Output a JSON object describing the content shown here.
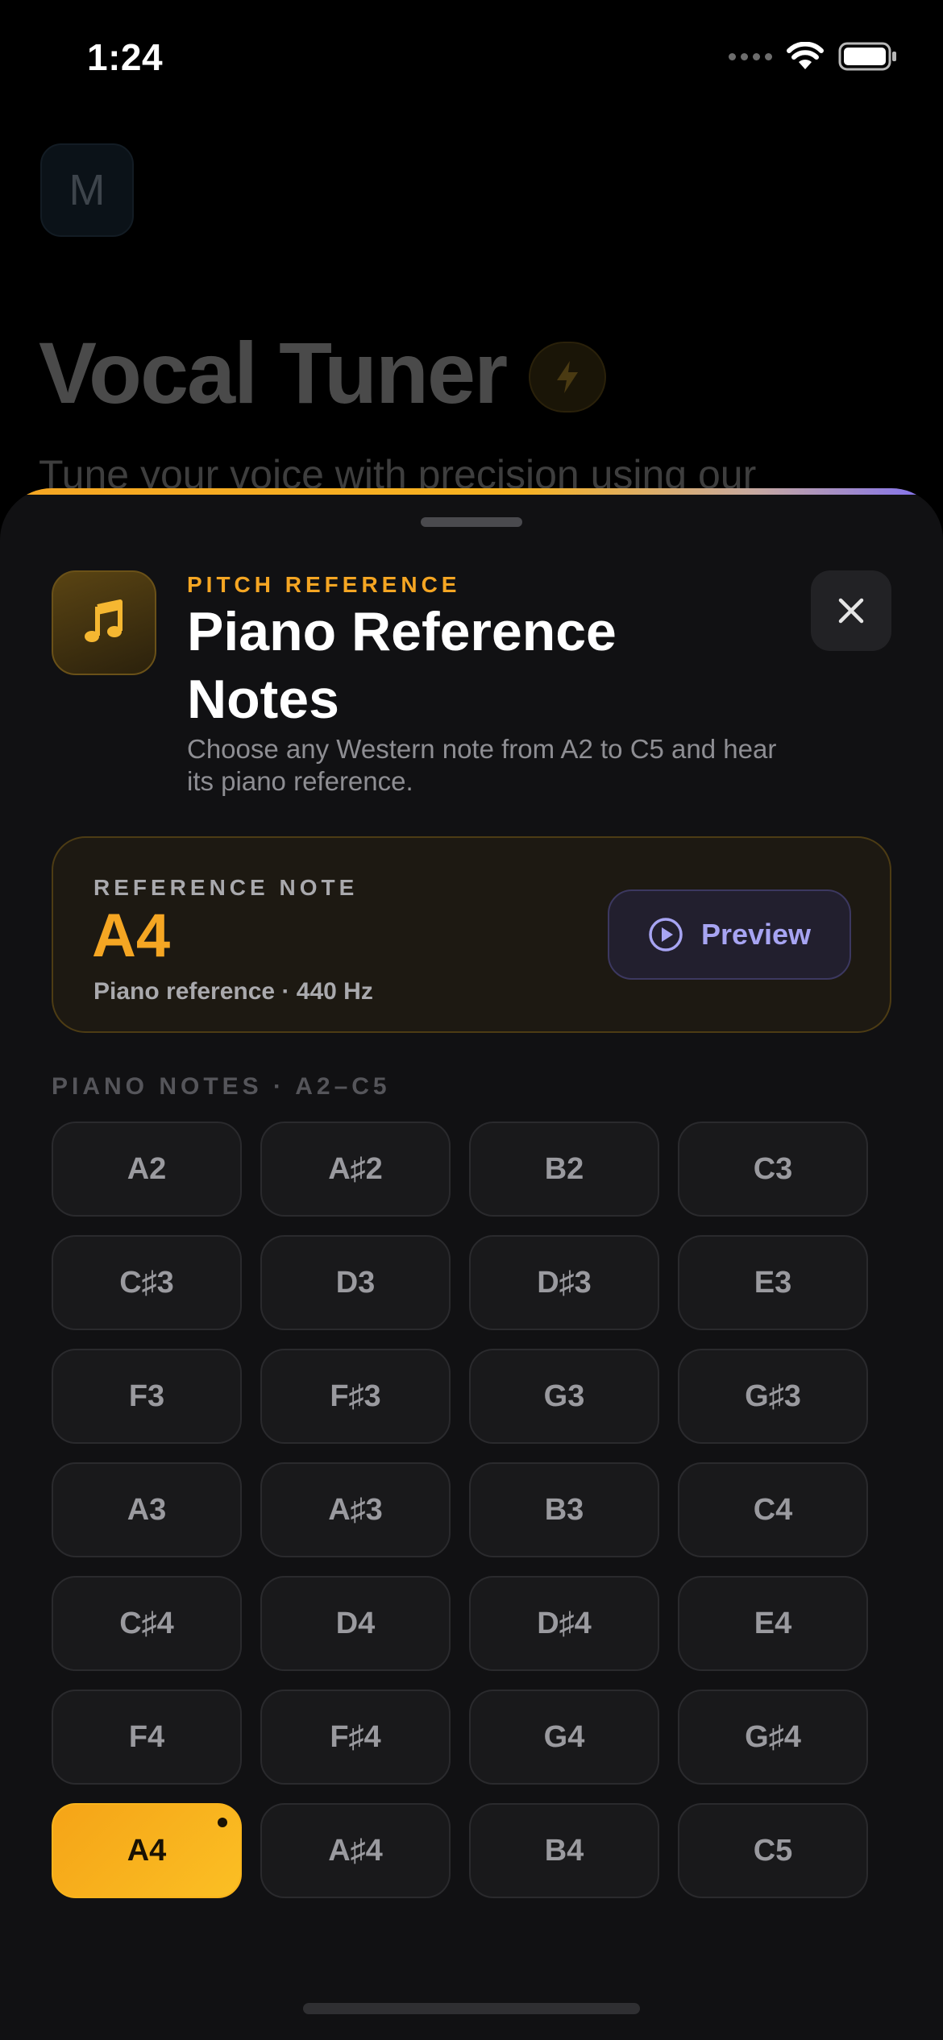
{
  "status_bar": {
    "time": "1:24"
  },
  "background_page": {
    "avatar_letter": "M",
    "title": "Vocal Tuner",
    "subtitle": "Tune your voice with precision using our"
  },
  "sheet": {
    "eyebrow": "PITCH REFERENCE",
    "title": "Piano Reference Notes",
    "description": "Choose any Western note from A2 to C5 and hear its piano reference.",
    "icon": "music-note-icon",
    "accent_color": "#f5a623",
    "reference_card": {
      "label": "REFERENCE NOTE",
      "note": "A4",
      "subtitle": "Piano reference · 440 Hz",
      "preview_label": "Preview"
    },
    "notes_section_label": "PIANO NOTES · A2–C5",
    "notes": [
      "A2",
      "A♯2",
      "B2",
      "C3",
      "C♯3",
      "D3",
      "D♯3",
      "E3",
      "F3",
      "F♯3",
      "G3",
      "G♯3",
      "A3",
      "A♯3",
      "B3",
      "C4",
      "C♯4",
      "D4",
      "D♯4",
      "E4",
      "F4",
      "F♯4",
      "G4",
      "G♯4",
      "A4",
      "A♯4",
      "B4",
      "C5"
    ],
    "selected_note": "A4"
  }
}
